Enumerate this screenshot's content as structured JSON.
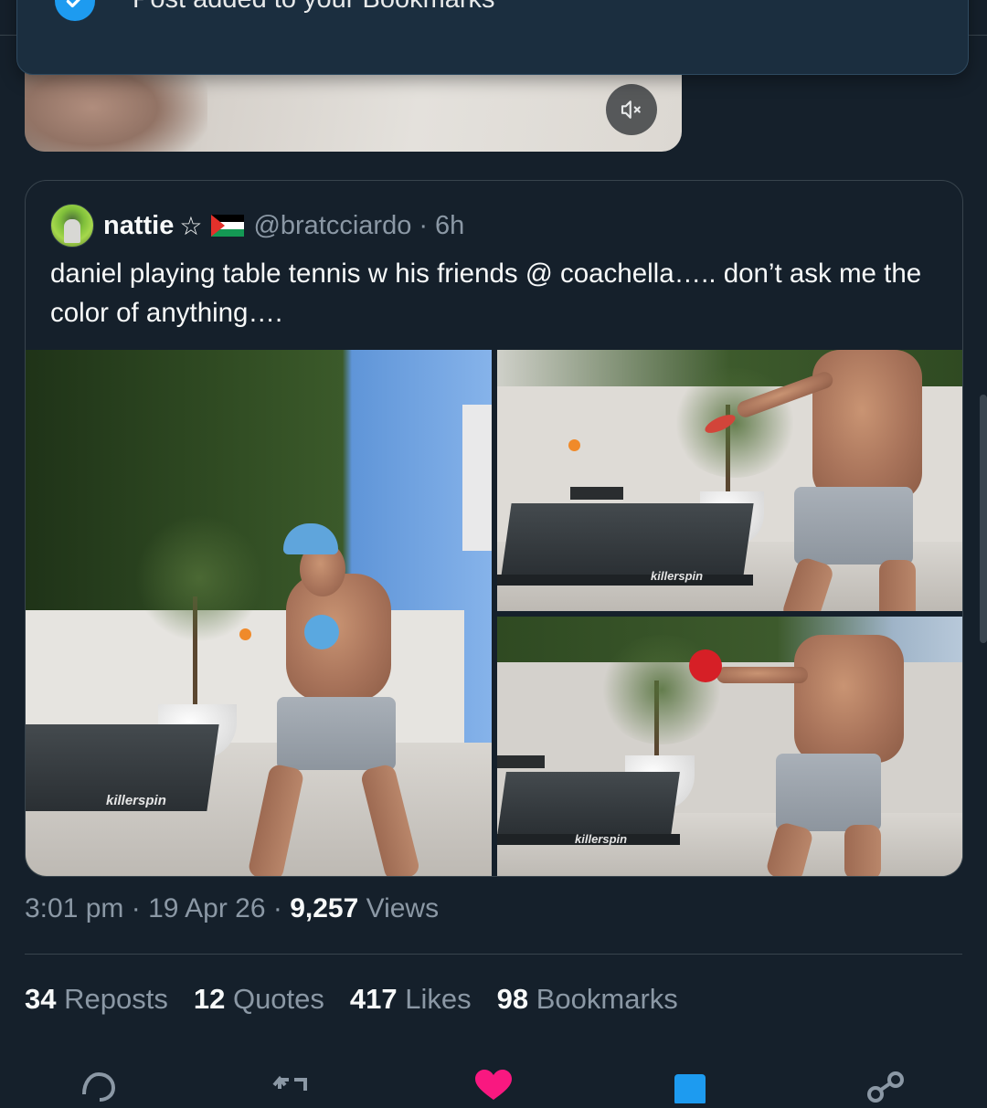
{
  "toast": {
    "message": "Post added to your Bookmarks",
    "icon": "check-circle-icon"
  },
  "video": {
    "mute_icon": "volume-muted-icon"
  },
  "quote": {
    "author_name": "nattie",
    "author_suffix": "☆",
    "flag_icon": "palestine-flag-icon",
    "handle": "@bratcciardo",
    "separator": "·",
    "time_ago": "6h",
    "text": "daniel playing table tennis w his friends @ coachella….. don’t ask me the color of anything….",
    "photos": [
      {
        "alt_brand": "killerspin"
      },
      {
        "alt_brand": "killerspin"
      },
      {
        "alt_brand": "killerspin"
      }
    ]
  },
  "meta": {
    "time": "3:01 pm",
    "sep1": " · ",
    "date": "19 Apr 26",
    "sep2": " · ",
    "views_count": "9,257",
    "views_label": " Views"
  },
  "stats": [
    {
      "count": "34",
      "label": "Reposts"
    },
    {
      "count": "12",
      "label": "Quotes"
    },
    {
      "count": "417",
      "label": "Likes"
    },
    {
      "count": "98",
      "label": "Bookmarks"
    }
  ],
  "actions": {
    "reply_icon": "reply-icon",
    "repost_icon": "repost-icon",
    "like_icon": "heart-icon",
    "bookmark_icon": "bookmark-icon",
    "share_icon": "share-icon",
    "like_color": "#f91880",
    "bookmark_color": "#1d9bf0"
  },
  "colors": {
    "background": "#15202b",
    "accent": "#1d9bf0",
    "secondary_text": "#8b98a5"
  }
}
